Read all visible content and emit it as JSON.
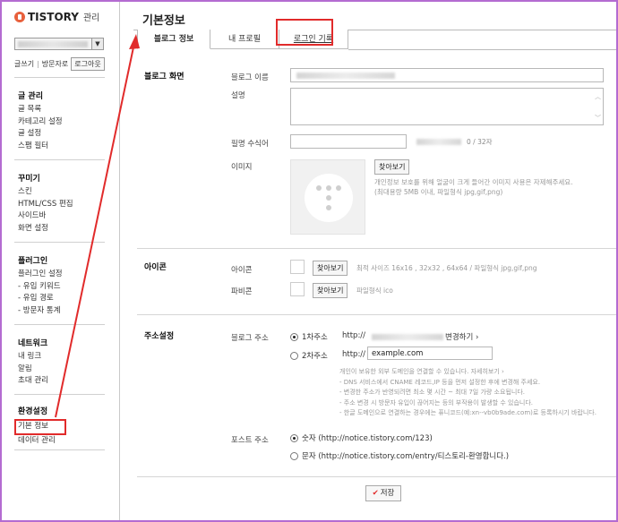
{
  "brand": {
    "name": "TISTORY",
    "sub": "관리"
  },
  "quick": {
    "write": "글쓰기",
    "notice": "방문자로",
    "logout": "로그아웃"
  },
  "sidebar": {
    "groups": [
      {
        "title": "글 관리",
        "items": [
          "글 목록",
          "카테고리 설정",
          "글 설정",
          "스팸 필터"
        ]
      },
      {
        "title": "꾸미기",
        "items": [
          "스킨",
          "HTML/CSS 편집",
          "사이드바",
          "화면 설정"
        ]
      },
      {
        "title": "플러그인",
        "items": [
          "플러그인 설정",
          "- 유입 키워드",
          "- 유입 경로",
          "- 방문자 통계"
        ]
      },
      {
        "title": "네트워크",
        "items": [
          "내 링크",
          "알림",
          "초대 관리"
        ]
      },
      {
        "title": "환경설정",
        "items": [
          "기본 정보",
          "데이터 관리"
        ]
      }
    ]
  },
  "page": {
    "title": "기본정보"
  },
  "tabs": [
    "블로그 정보",
    "내 프로필",
    "로그인 기록"
  ],
  "blog_screen": {
    "section_title": "블로그 화면",
    "name_label": "블로그 이름",
    "desc_label": "설명",
    "nickname_label": "필명 수식어",
    "counter": "0 / 32자",
    "image_label": "이미지",
    "find": "찾아보기",
    "image_hint_1": "개인정보 보호를 위해 얼굴이 크게 들어간 이미지 사용은 자제해주세요.",
    "image_hint_2": "(최대용량 5MB 이내, 파일형식 jpg,gif,png)"
  },
  "icon_section": {
    "section_title": "아이콘",
    "icon_label": "아이콘",
    "icon_hint": "최적 사이즈 16x16 , 32x32 , 64x64 / 파일형식 jpg,gif,png",
    "favicon_label": "파비콘",
    "favicon_hint": "파일형식 ico",
    "find": "찾아보기"
  },
  "address": {
    "section_title": "주소설정",
    "blog_addr_label": "블로그 주소",
    "primary": "1차주소",
    "primary_prefix": "http://",
    "primary_change": "변경하기 ›",
    "secondary": "2차주소",
    "secondary_prefix": "http://",
    "secondary_value": "example.com",
    "notes": [
      "개인이 보유한 외부 도메인을 연결할 수 있습니다. 자세히보기 ›",
      "- DNS 서비스에서 CNAME 레코드,IP 등을 먼저 설정한 후에 변경해 주세요.",
      "- 변경한 주소가 반영되려면 최소 몇 시간 ~ 최대 7일 가량 소요됩니다.",
      "- 주소 변경 시 방문자 유입이 끊어지는 등의 부작용이 발생할 수 있습니다.",
      "- 한글 도메인으로 연결하는 경우에는 퓨니코드(예:xn--vb0b9ade.com)로 등록하시기 바랍니다."
    ],
    "post_addr_label": "포스트 주소",
    "post_opt_1": "숫자 (http://notice.tistory.com/123)",
    "post_opt_2": "문자 (http://notice.tistory.com/entry/티스토리-환영합니다.)"
  },
  "save": "저장",
  "colors": {
    "accent": "#e12b2b",
    "frame": "#b46bd1",
    "brand": "#e8603c"
  }
}
